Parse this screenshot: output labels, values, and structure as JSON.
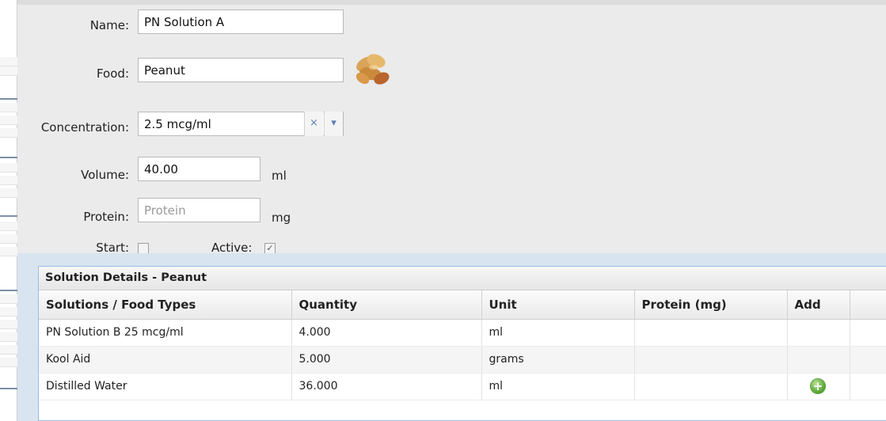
{
  "form": {
    "name_label": "Name:",
    "name_value": "PN Solution A",
    "food_label": "Food:",
    "food_value": "Peanut",
    "food_icon": "peanut-icon",
    "concentration_label": "Concentration:",
    "concentration_value": "2.5 mcg/ml",
    "concentration_clear_icon": "×",
    "concentration_dropdown_icon": "▾",
    "volume_label": "Volume:",
    "volume_value": "40.00",
    "volume_unit": "ml",
    "protein_label": "Protein:",
    "protein_value": "",
    "protein_placeholder": "Protein",
    "protein_unit": "mg",
    "start_label": "Start:",
    "start_checked": false,
    "active_label": "Active:",
    "active_checked": true
  },
  "details": {
    "title": "Solution Details - Peanut",
    "columns": [
      "Solutions / Food Types",
      "Quantity",
      "Unit",
      "Protein (mg)",
      "Add"
    ],
    "rows": [
      {
        "food": "PN Solution B 25 mcg/ml",
        "quantity": "4.000",
        "unit": "ml",
        "protein": "",
        "add_icon": false
      },
      {
        "food": "Kool Aid",
        "quantity": "5.000",
        "unit": "grams",
        "protein": "",
        "add_icon": false
      },
      {
        "food": "Distilled Water",
        "quantity": "36.000",
        "unit": "ml",
        "protein": "",
        "add_icon": true
      }
    ],
    "add_icon_glyph": "+"
  },
  "colors": {
    "panel_bg": "#ebebeb",
    "grid_border": "#99bbe8",
    "add_icon_green": "#5aa635"
  }
}
